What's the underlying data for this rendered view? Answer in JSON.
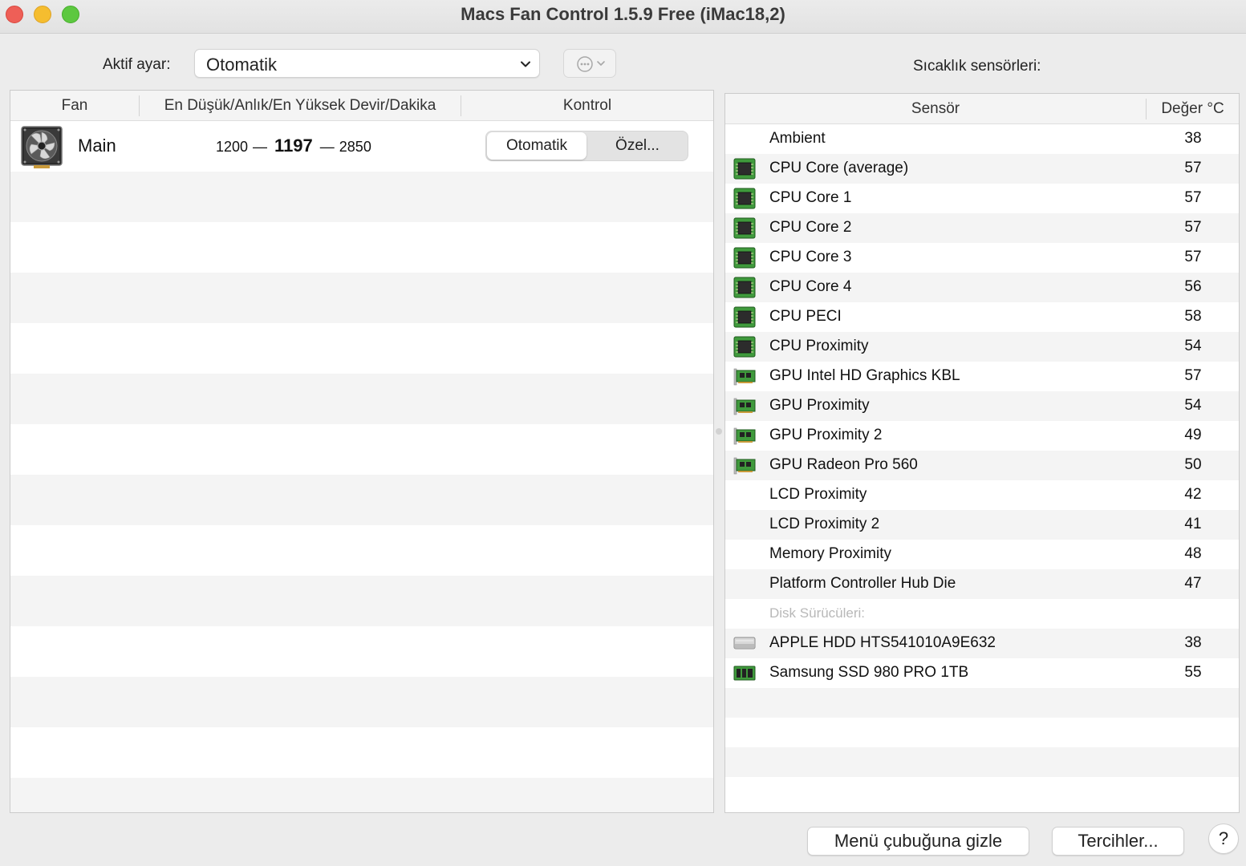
{
  "window": {
    "title": "Macs Fan Control 1.5.9 Free (iMac18,2)"
  },
  "toolbar": {
    "preset_label": "Aktif ayar:",
    "preset_value": "Otomatik",
    "sensors_title": "Sıcaklık sensörleri:"
  },
  "fan_table": {
    "headers": [
      "Fan",
      "En Düşük/Anlık/En Yüksek Devir/Dakika",
      "Kontrol"
    ],
    "fans": [
      {
        "name": "Main",
        "min_rpm": "1200",
        "current_rpm": "1197",
        "max_rpm": "2850",
        "auto_label": "Otomatik",
        "custom_label": "Özel...",
        "icon": "fan-icon"
      }
    ]
  },
  "sensor_table": {
    "headers": [
      "Sensör",
      "Değer °C"
    ],
    "rows": [
      {
        "name": "Ambient",
        "value": "38",
        "icon": "none"
      },
      {
        "name": "CPU Core (average)",
        "value": "57",
        "icon": "cpu-chip-icon"
      },
      {
        "name": "CPU Core 1",
        "value": "57",
        "icon": "cpu-chip-icon"
      },
      {
        "name": "CPU Core 2",
        "value": "57",
        "icon": "cpu-chip-icon"
      },
      {
        "name": "CPU Core 3",
        "value": "57",
        "icon": "cpu-chip-icon"
      },
      {
        "name": "CPU Core 4",
        "value": "56",
        "icon": "cpu-chip-icon"
      },
      {
        "name": "CPU PECI",
        "value": "58",
        "icon": "cpu-chip-icon"
      },
      {
        "name": "CPU Proximity",
        "value": "54",
        "icon": "cpu-chip-icon"
      },
      {
        "name": "GPU Intel HD Graphics KBL",
        "value": "57",
        "icon": "gpu-card-icon"
      },
      {
        "name": "GPU Proximity",
        "value": "54",
        "icon": "gpu-card-icon"
      },
      {
        "name": "GPU Proximity 2",
        "value": "49",
        "icon": "gpu-card-icon"
      },
      {
        "name": "GPU Radeon Pro 560",
        "value": "50",
        "icon": "gpu-card-icon"
      },
      {
        "name": "LCD Proximity",
        "value": "42",
        "icon": "none"
      },
      {
        "name": "LCD Proximity 2",
        "value": "41",
        "icon": "none"
      },
      {
        "name": "Memory Proximity",
        "value": "48",
        "icon": "none"
      },
      {
        "name": "Platform Controller Hub Die",
        "value": "47",
        "icon": "none"
      },
      {
        "group": "Disk Sürücüleri:"
      },
      {
        "name": "APPLE HDD HTS541010A9E632",
        "value": "38",
        "icon": "hdd-icon"
      },
      {
        "name": "Samsung SSD 980 PRO 1TB",
        "value": "55",
        "icon": "ssd-icon"
      }
    ]
  },
  "footer": {
    "hide_label": "Menü çubuğuna gizle",
    "prefs_label": "Tercihler...",
    "help_label": "?"
  },
  "colors": {
    "close": "#ee5f57",
    "minimize": "#f5bd2f",
    "maximize": "#5dc840",
    "chip_green": "#3f9a3c"
  }
}
